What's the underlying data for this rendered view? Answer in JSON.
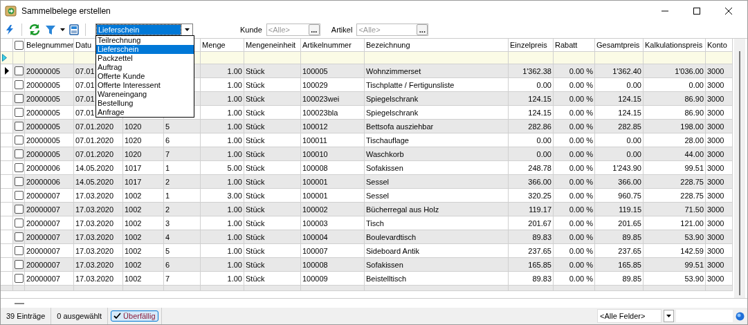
{
  "window": {
    "title": "Sammelbelege erstellen"
  },
  "toolbar": {
    "document_type": {
      "value": "Lieferschein",
      "expanded": true,
      "options": [
        {
          "label": "Teilrechnung",
          "selected": false
        },
        {
          "label": "Lieferschein",
          "selected": true
        },
        {
          "label": "Packzettel",
          "selected": false
        },
        {
          "label": "Auftrag",
          "selected": false
        },
        {
          "label": "Offerte Kunde",
          "selected": false
        },
        {
          "label": "Offerte Interessent",
          "selected": false
        },
        {
          "label": "Wareneingang",
          "selected": false
        },
        {
          "label": "Bestellung",
          "selected": false
        },
        {
          "label": "Anfrage",
          "selected": false
        }
      ]
    },
    "filters": [
      {
        "label": "Kunde",
        "placeholder": "<Alle>",
        "button": "..."
      },
      {
        "label": "Artikel",
        "placeholder": "<Alle>",
        "button": "..."
      }
    ]
  },
  "table": {
    "select_all": {
      "checked": false
    },
    "columns": [
      "Belegnummer",
      "Datu",
      null,
      null,
      "Menge",
      "Mengeneinheit",
      "Artikelnummer",
      "Bezeichnung",
      "Einzelpreis",
      "Rabatt",
      "Gesamtpreis",
      "Kalkulationspreis",
      "Konto"
    ],
    "rows": [
      {
        "current": true,
        "checked": false,
        "cells": [
          "20000005",
          "07.01",
          null,
          null,
          "1.00",
          "Stück",
          "100005",
          "Wohnzimmerset",
          "1'362.38",
          "0.00 %",
          "1'362.40",
          "1'036.00",
          "3000"
        ]
      },
      {
        "current": false,
        "checked": false,
        "cells": [
          "20000005",
          "07.01",
          null,
          null,
          "1.00",
          "Stück",
          "100029",
          "Tischplatte / Fertigunsliste",
          "0.00",
          "0.00 %",
          "0.00",
          "0.00",
          "3000"
        ]
      },
      {
        "current": false,
        "checked": false,
        "cells": [
          "20000005",
          "07.01",
          null,
          null,
          "1.00",
          "Stück",
          "100023wei",
          "Spiegelschrank",
          "124.15",
          "0.00 %",
          "124.15",
          "86.90",
          "3000"
        ]
      },
      {
        "current": false,
        "checked": false,
        "cells": [
          "20000005",
          "07.01",
          null,
          null,
          "1.00",
          "Stück",
          "100023bla",
          "Spiegelschrank",
          "124.15",
          "0.00 %",
          "124.15",
          "86.90",
          "3000"
        ]
      },
      {
        "current": false,
        "checked": false,
        "cells": [
          "20000005",
          "07.01.2020",
          "1020",
          "5",
          "1.00",
          "Stück",
          "100012",
          "Bettsofa ausziehbar",
          "282.86",
          "0.00 %",
          "282.85",
          "198.00",
          "3000"
        ]
      },
      {
        "current": false,
        "checked": false,
        "cells": [
          "20000005",
          "07.01.2020",
          "1020",
          "6",
          "1.00",
          "Stück",
          "100011",
          "Tischauflage",
          "0.00",
          "0.00 %",
          "0.00",
          "28.00",
          "3000"
        ]
      },
      {
        "current": false,
        "checked": false,
        "cells": [
          "20000005",
          "07.01.2020",
          "1020",
          "7",
          "1.00",
          "Stück",
          "100010",
          "Waschkorb",
          "0.00",
          "0.00 %",
          "0.00",
          "44.00",
          "3000"
        ]
      },
      {
        "current": false,
        "checked": false,
        "cells": [
          "20000006",
          "14.05.2020",
          "1017",
          "1",
          "5.00",
          "Stück",
          "100008",
          "Sofakissen",
          "248.78",
          "0.00 %",
          "1'243.90",
          "99.51",
          "3000"
        ]
      },
      {
        "current": false,
        "checked": false,
        "cells": [
          "20000006",
          "14.05.2020",
          "1017",
          "2",
          "1.00",
          "Stück",
          "100001",
          "Sessel",
          "366.00",
          "0.00 %",
          "366.00",
          "228.75",
          "3000"
        ]
      },
      {
        "current": false,
        "checked": false,
        "cells": [
          "20000007",
          "17.03.2020",
          "1002",
          "1",
          "3.00",
          "Stück",
          "100001",
          "Sessel",
          "320.25",
          "0.00 %",
          "960.75",
          "228.75",
          "3000"
        ]
      },
      {
        "current": false,
        "checked": false,
        "cells": [
          "20000007",
          "17.03.2020",
          "1002",
          "2",
          "1.00",
          "Stück",
          "100002",
          "Bücherregal aus Holz",
          "119.17",
          "0.00 %",
          "119.15",
          "71.50",
          "3000"
        ]
      },
      {
        "current": false,
        "checked": false,
        "cells": [
          "20000007",
          "17.03.2020",
          "1002",
          "3",
          "1.00",
          "Stück",
          "100003",
          "Tisch",
          "201.67",
          "0.00 %",
          "201.65",
          "121.00",
          "3000"
        ]
      },
      {
        "current": false,
        "checked": false,
        "cells": [
          "20000007",
          "17.03.2020",
          "1002",
          "4",
          "1.00",
          "Stück",
          "100004",
          "Boulevardtisch",
          "89.83",
          "0.00 %",
          "89.85",
          "53.90",
          "3000"
        ]
      },
      {
        "current": false,
        "checked": false,
        "cells": [
          "20000007",
          "17.03.2020",
          "1002",
          "5",
          "1.00",
          "Stück",
          "100007",
          "Sideboard Antik",
          "237.65",
          "0.00 %",
          "237.65",
          "142.59",
          "3000"
        ]
      },
      {
        "current": false,
        "checked": false,
        "cells": [
          "20000007",
          "17.03.2020",
          "1002",
          "6",
          "1.00",
          "Stück",
          "100008",
          "Sofakissen",
          "165.85",
          "0.00 %",
          "165.85",
          "99.51",
          "3000"
        ]
      },
      {
        "current": false,
        "checked": false,
        "cells": [
          "20000007",
          "17.03.2020",
          "1002",
          "7",
          "1.00",
          "Stück",
          "100009",
          "Beistelltisch",
          "89.83",
          "0.00 %",
          "89.85",
          "53.90",
          "3000"
        ]
      }
    ]
  },
  "status_bar": {
    "count": "39 Einträge",
    "selected": "0 ausgewählt",
    "overdue": {
      "label": "Überfällig",
      "on": true
    },
    "field_filter": "<Alle Felder>"
  }
}
